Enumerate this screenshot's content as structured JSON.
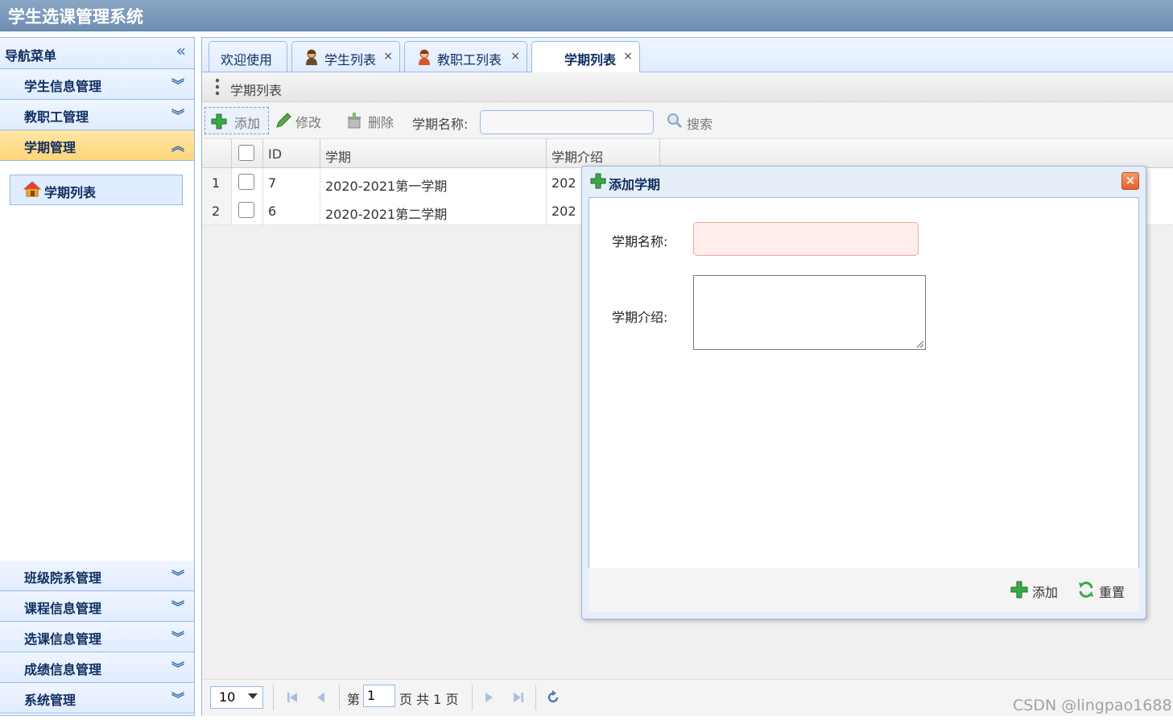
{
  "app": {
    "title": "学生选课管理系统"
  },
  "nav": {
    "header": "导航菜单",
    "items": [
      {
        "label": "学生信息管理",
        "expanded": false
      },
      {
        "label": "教职工管理",
        "expanded": false
      },
      {
        "label": "学期管理",
        "expanded": true
      },
      {
        "label": "班级院系管理",
        "expanded": false
      },
      {
        "label": "课程信息管理",
        "expanded": false
      },
      {
        "label": "选课信息管理",
        "expanded": false
      },
      {
        "label": "成绩信息管理",
        "expanded": false
      },
      {
        "label": "系统管理",
        "expanded": false
      }
    ],
    "active_children": [
      {
        "label": "学期列表",
        "icon": "home-icon"
      }
    ]
  },
  "tabs": [
    {
      "label": "欢迎使用",
      "closable": false,
      "icon": null
    },
    {
      "label": "学生列表",
      "closable": true,
      "icon": "user-icon"
    },
    {
      "label": "教职工列表",
      "closable": true,
      "icon": "user-icon"
    },
    {
      "label": "学期列表",
      "closable": true,
      "icon": null,
      "selected": true
    }
  ],
  "tab_close_glyph": "×",
  "panel": {
    "title": "学期列表"
  },
  "toolbar": {
    "add": "添加",
    "edit": "修改",
    "delete": "删除",
    "query_label": "学期名称:",
    "query_value": "",
    "search": "搜索"
  },
  "grid": {
    "columns": [
      "ID",
      "学期",
      "学期介绍"
    ],
    "rows": [
      {
        "num": "1",
        "id": "7",
        "term": "2020-2021第一学期",
        "intro": "202"
      },
      {
        "num": "2",
        "id": "6",
        "term": "2020-2021第二学期",
        "intro": "202"
      }
    ]
  },
  "pager": {
    "page_size": "10",
    "page_prefix": "第",
    "page_value": "1",
    "page_suffix": "页 共 1 页"
  },
  "dialog": {
    "title": "添加学期",
    "close_glyph": "×",
    "name_label": "学期名称:",
    "name_value": "",
    "desc_label": "学期介绍:",
    "desc_value": "",
    "add_button": "添加",
    "reset_button": "重置"
  },
  "watermark": "CSDN @lingpao1688",
  "colors": {
    "accent_border": "#95b8e7",
    "active_nav": "#ffd57a",
    "header_bg": "#6f8eb3",
    "invalid_field": "#ffeeeb"
  }
}
